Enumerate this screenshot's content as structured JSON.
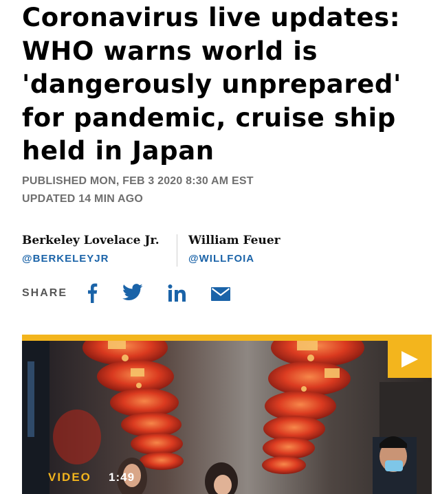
{
  "article": {
    "headline": "Coronavirus live updates: WHO warns world is 'dangerously unprepared' for pandemic, cruise ship held in Japan",
    "published": "PUBLISHED MON, FEB 3 2020 8:30 AM EST",
    "updated": "UPDATED 14 MIN AGO"
  },
  "authors": [
    {
      "name": "Berkeley Lovelace Jr.",
      "handle": "@BERKELEYJR"
    },
    {
      "name": "William Feuer",
      "handle": "@WILLFOIA"
    }
  ],
  "share": {
    "label": "SHARE",
    "icons": [
      "facebook-icon",
      "twitter-icon",
      "linkedin-icon",
      "email-icon"
    ],
    "icon_color": "#1a63a8"
  },
  "video": {
    "label": "VIDEO",
    "duration": "1:49",
    "accent_color": "#f3b51d"
  }
}
